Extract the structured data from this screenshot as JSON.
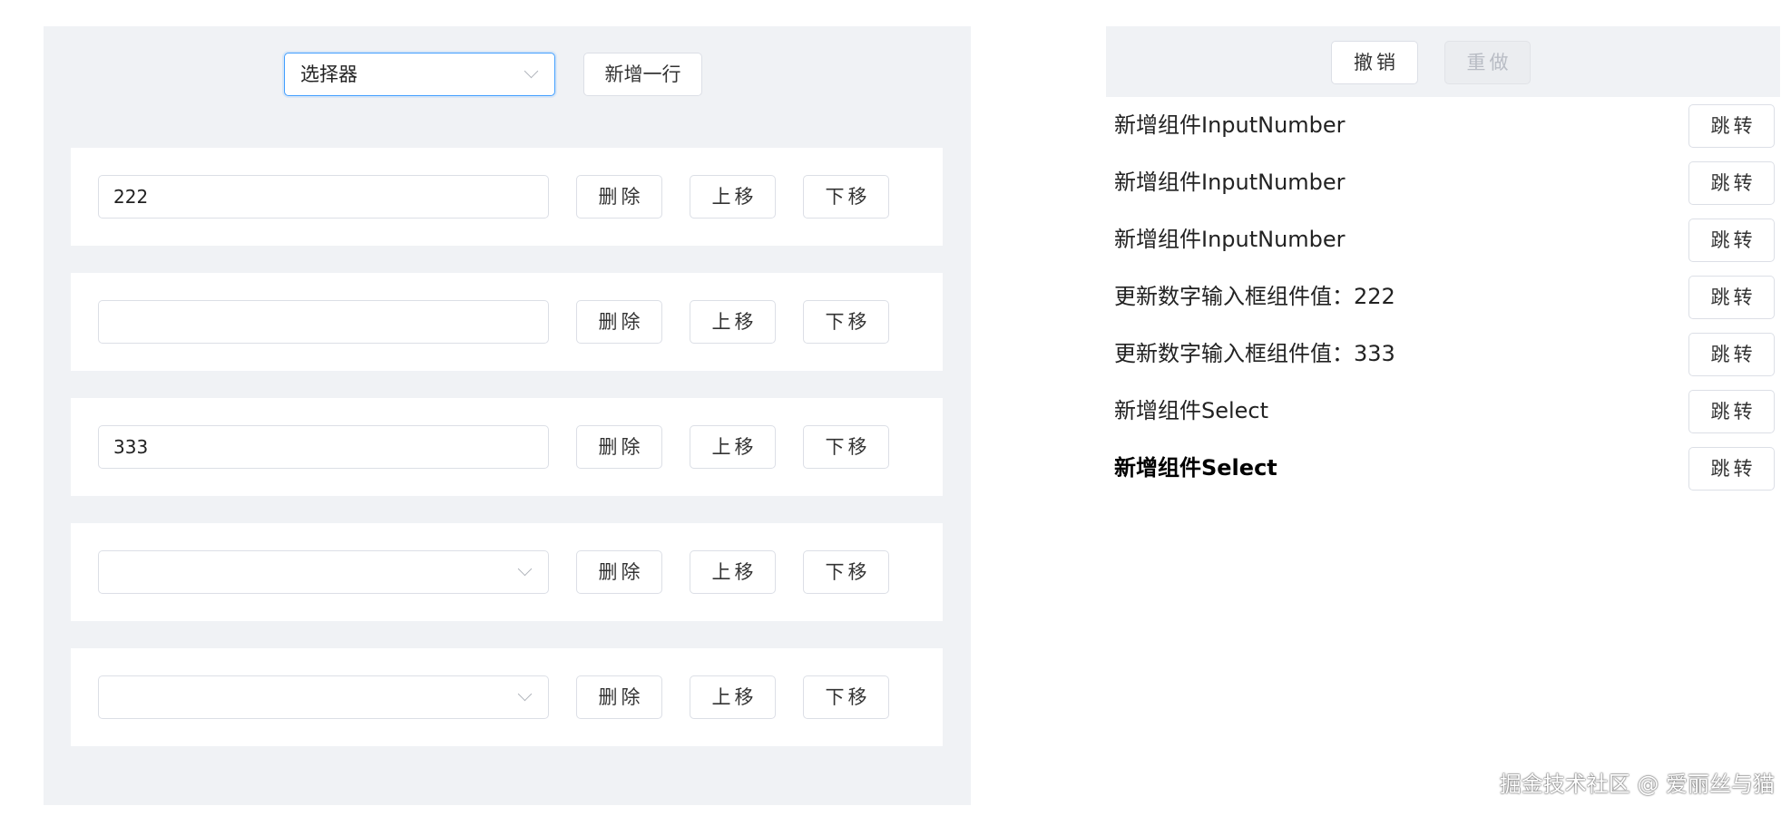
{
  "editor": {
    "selector": {
      "value": "选择器"
    },
    "add_row_label": "新增一行",
    "rows": [
      {
        "field_type": "input-number",
        "value": "222",
        "delete_label": "删除",
        "up_label": "上移",
        "down_label": "下移"
      },
      {
        "field_type": "input-number",
        "value": "",
        "delete_label": "删除",
        "up_label": "上移",
        "down_label": "下移"
      },
      {
        "field_type": "input-number",
        "value": "333",
        "delete_label": "删除",
        "up_label": "上移",
        "down_label": "下移"
      },
      {
        "field_type": "select",
        "value": "",
        "delete_label": "删除",
        "up_label": "上移",
        "down_label": "下移"
      },
      {
        "field_type": "select",
        "value": "",
        "delete_label": "删除",
        "up_label": "上移",
        "down_label": "下移"
      }
    ]
  },
  "history": {
    "undo_label": "撤销",
    "redo_label": "重做",
    "redo_disabled": true,
    "items": [
      {
        "text": "新增组件InputNumber",
        "jump_label": "跳转",
        "current": false
      },
      {
        "text": "新增组件InputNumber",
        "jump_label": "跳转",
        "current": false
      },
      {
        "text": "新增组件InputNumber",
        "jump_label": "跳转",
        "current": false
      },
      {
        "text": "更新数字输入框组件值：222",
        "jump_label": "跳转",
        "current": false
      },
      {
        "text": "更新数字输入框组件值：333",
        "jump_label": "跳转",
        "current": false
      },
      {
        "text": "新增组件Select",
        "jump_label": "跳转",
        "current": false
      },
      {
        "text": "新增组件Select",
        "jump_label": "跳转",
        "current": true
      }
    ]
  },
  "watermark": "掘金技术社区 @ 爱丽丝与猫",
  "colors": {
    "panel_bg": "#f0f2f5",
    "focus_border": "#409eff",
    "border": "#dcdfe6",
    "disabled_text": "#b8bcc4"
  },
  "icons": {
    "select_arrow": "chevron-down-icon"
  }
}
